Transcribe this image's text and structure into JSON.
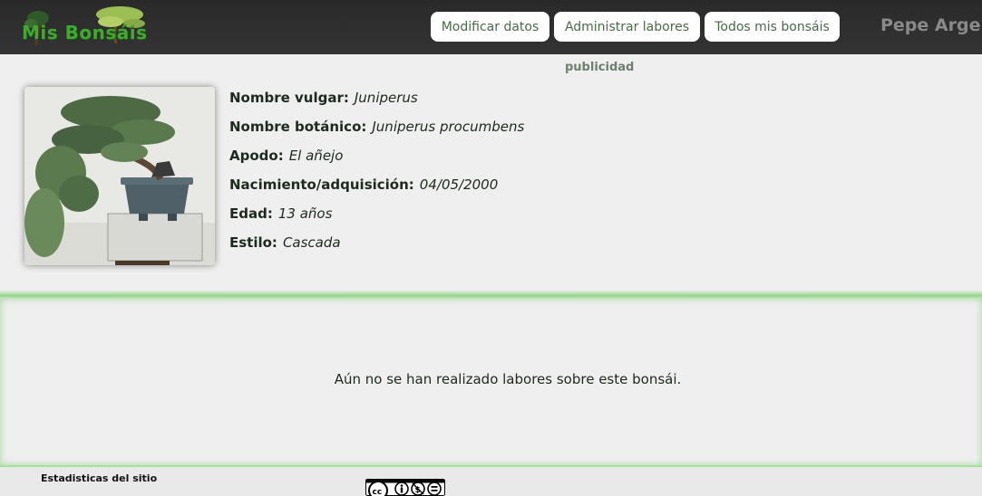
{
  "header": {
    "logo_text": "Mis Bonsáis",
    "nav": {
      "modify": "Modificar datos",
      "administer": "Administrar labores",
      "all": "Todos mis bonsáis"
    },
    "user_name": "Pepe Argen"
  },
  "ad_label": "publicidad",
  "bonsai": {
    "photo_icon": "bonsai-photo",
    "fields": [
      {
        "label": "Nombre vulgar:",
        "value": "Juniperus"
      },
      {
        "label": "Nombre botánico:",
        "value": "Juniperus procumbens"
      },
      {
        "label": "Apodo:",
        "value": "El añejo"
      },
      {
        "label": "Nacimiento/adquisición:",
        "value": "04/05/2000"
      },
      {
        "label": "Edad:",
        "value": "13 años"
      },
      {
        "label": "Estilo:",
        "value": "Cascada"
      }
    ]
  },
  "tasks": {
    "empty_message": "Aún no se han realizado labores sobre este bonsái."
  },
  "footer": {
    "stats_title": "Estadisticas del sitio",
    "license_icon": "creative-commons-by-nc-nd-icon"
  },
  "colors": {
    "accent_green": "#8fd487",
    "logo_green": "#3faa2e",
    "topbar": "#2f2f2f"
  }
}
